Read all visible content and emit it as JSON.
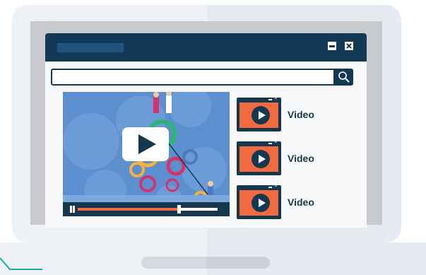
{
  "window": {
    "minimize_icon": "minimize-icon",
    "close_icon": "close-icon"
  },
  "search": {
    "value": "",
    "icon": "search-icon"
  },
  "player": {
    "progress": 0.72,
    "play_icon": "play-icon",
    "pause_icon": "pause-icon"
  },
  "videos": [
    {
      "label": "Video"
    },
    {
      "label": "Video"
    },
    {
      "label": "Video"
    }
  ],
  "colors": {
    "navy": "#123a57",
    "accent": "#f26a3d",
    "base_accent": "#1fa8a1"
  }
}
